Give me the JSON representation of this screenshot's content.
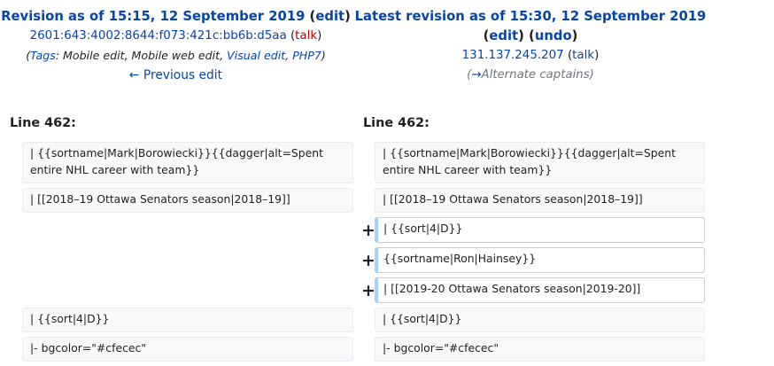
{
  "left": {
    "title_prefix": "Revision as of 15:15, 12 September 2019",
    "edit": "edit",
    "user": "2601:643:4002:8644:f073:421c:bb6b:d5aa",
    "talk": "talk",
    "tags_label": "Tags",
    "tag_mobile_edit": "Mobile edit",
    "tag_mobile_web_edit": "Mobile web edit",
    "tag_visual_edit": "Visual edit",
    "tag_php7": "PHP7",
    "prev_edit": "← Previous edit",
    "line_label": "Line 462:"
  },
  "right": {
    "title_prefix": "Latest revision as of 15:30, 12 September 2019",
    "edit": "edit",
    "undo": "undo",
    "user": "131.137.245.207",
    "talk": "talk",
    "summary_arrow": "→",
    "summary_text": "Alternate captains",
    "line_label": "Line 462:"
  },
  "diff": {
    "left_cells": [
      "| {{sortname|Mark|Borowiecki}}{{dagger|alt=Spent entire NHL career with team}}",
      "| [[2018–19 Ottawa Senators season|2018–19]]",
      "| {{sort|4|D}}",
      "|- bgcolor=\"#cfecec\""
    ],
    "right_cells": [
      "| {{sortname|Mark|Borowiecki}}{{dagger|alt=Spent entire NHL career with team}}",
      "| [[2018–19 Ottawa Senators season|2018–19]]",
      "| {{sort|4|D}}",
      "{{sortname|Ron|Hainsey}}",
      "| [[2019-20 Ottawa Senators season|2019-20]]",
      "| {{sort|4|D}}",
      "|- bgcolor=\"#cfecec\""
    ],
    "plus": "+"
  }
}
